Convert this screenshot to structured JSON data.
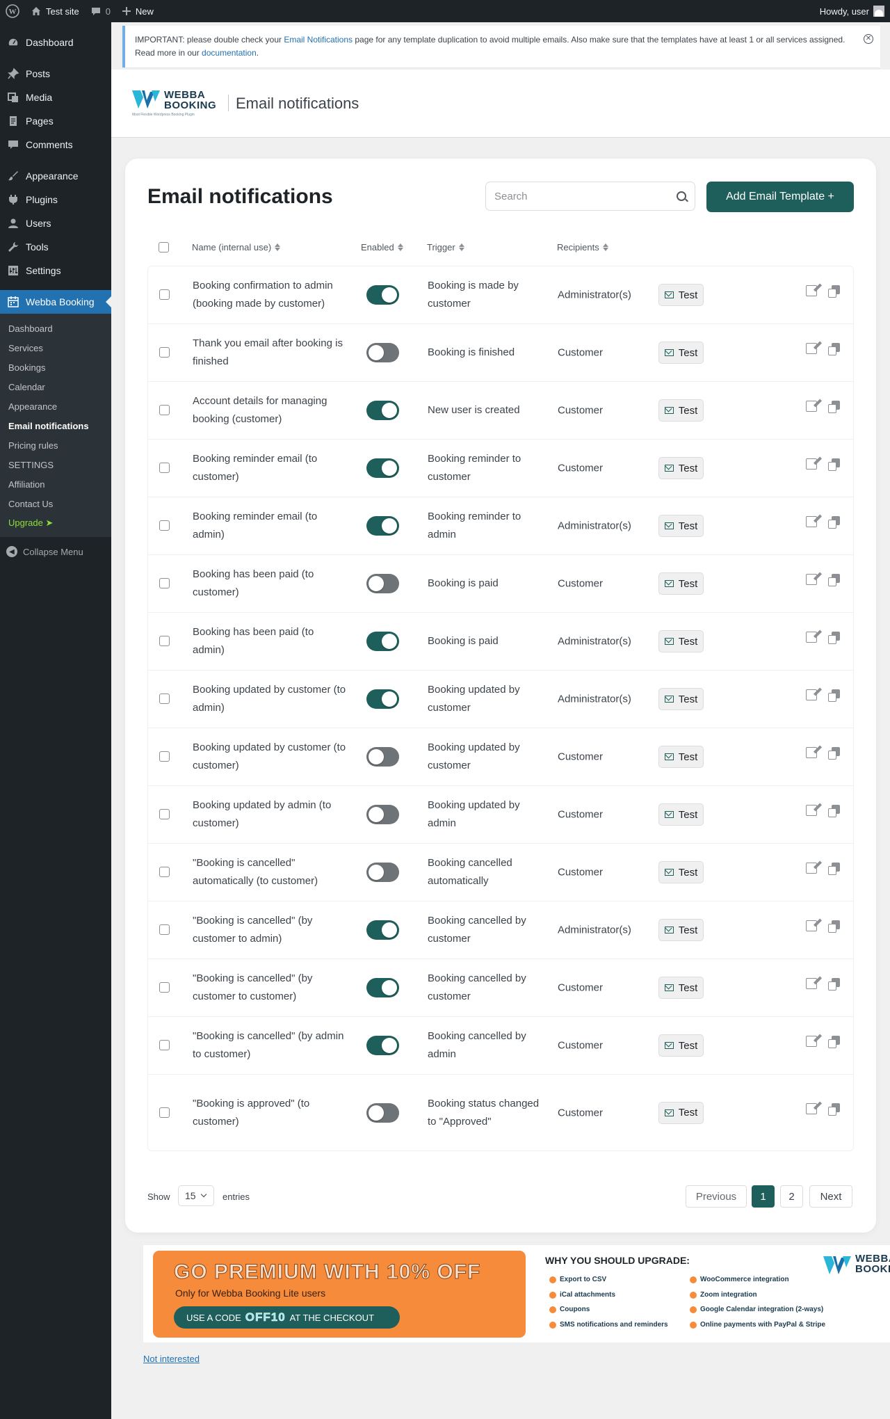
{
  "adminbar": {
    "site_name": "Test site",
    "comments_count": "0",
    "new_label": "New",
    "howdy": "Howdy, user"
  },
  "sidebar": {
    "items": [
      {
        "label": "Dashboard",
        "icon": "dashboard-icon"
      },
      {
        "label": "Posts",
        "icon": "pin-icon"
      },
      {
        "label": "Media",
        "icon": "media-icon"
      },
      {
        "label": "Pages",
        "icon": "pages-icon"
      },
      {
        "label": "Comments",
        "icon": "comment-icon"
      },
      {
        "label": "Appearance",
        "icon": "brush-icon"
      },
      {
        "label": "Plugins",
        "icon": "plug-icon"
      },
      {
        "label": "Users",
        "icon": "user-icon"
      },
      {
        "label": "Tools",
        "icon": "wrench-icon"
      },
      {
        "label": "Settings",
        "icon": "settings-icon"
      },
      {
        "label": "Webba Booking",
        "icon": "calendar-icon"
      }
    ],
    "submenu": [
      "Dashboard",
      "Services",
      "Bookings",
      "Calendar",
      "Appearance",
      "Email notifications",
      "Pricing rules",
      "SETTINGS",
      "Affiliation",
      "Contact Us",
      "Upgrade ➤"
    ],
    "collapse_label": "Collapse Menu"
  },
  "notice": {
    "text_before": "IMPORTANT: please double check your ",
    "link1": "Email Notifications",
    "text_middle": " page for any template duplication to avoid multiple emails. Also make sure that the templates have at least 1 or all services assigned. Read more in our ",
    "link2": "documentation",
    "text_after": "."
  },
  "header": {
    "logo_line1": "WEBBA",
    "logo_line2": "BOOKING",
    "logo_tagline": "Most Flexible Wordpress Booking Plugin",
    "title": "Email notifications"
  },
  "main": {
    "title": "Email notifications",
    "search_placeholder": "Search",
    "add_button": "Add Email Template +",
    "columns": {
      "name": "Name (internal use)",
      "enabled": "Enabled",
      "trigger": "Trigger",
      "recipients": "Recipients"
    },
    "test_label": "Test",
    "rows": [
      {
        "name": "Booking confirmation to admin (booking made by customer)",
        "enabled": true,
        "trigger": "Booking is made by customer",
        "recipients": "Administrator(s)"
      },
      {
        "name": "Thank you email after booking is finished",
        "enabled": false,
        "trigger": "Booking is finished",
        "recipients": "Customer"
      },
      {
        "name": "Account details for managing booking (customer)",
        "enabled": true,
        "trigger": "New user is created",
        "recipients": "Customer"
      },
      {
        "name": "Booking reminder email (to customer)",
        "enabled": true,
        "trigger": "Booking reminder to customer",
        "recipients": "Customer"
      },
      {
        "name": "Booking reminder email (to admin)",
        "enabled": true,
        "trigger": "Booking reminder to admin",
        "recipients": "Administrator(s)"
      },
      {
        "name": "Booking has been paid (to customer)",
        "enabled": false,
        "trigger": "Booking is paid",
        "recipients": "Customer"
      },
      {
        "name": "Booking has been paid (to admin)",
        "enabled": true,
        "trigger": "Booking is paid",
        "recipients": "Administrator(s)"
      },
      {
        "name": "Booking updated by customer (to admin)",
        "enabled": true,
        "trigger": "Booking updated by customer",
        "recipients": "Administrator(s)"
      },
      {
        "name": "Booking updated by customer (to customer)",
        "enabled": false,
        "trigger": "Booking updated by customer",
        "recipients": "Customer"
      },
      {
        "name": "Booking updated by admin (to customer)",
        "enabled": false,
        "trigger": "Booking updated by admin",
        "recipients": "Customer"
      },
      {
        "name": "\"Booking is cancelled\" automatically (to customer)",
        "enabled": false,
        "trigger": "Booking cancelled automatically",
        "recipients": "Customer"
      },
      {
        "name": "\"Booking is cancelled\" (by customer to admin)",
        "enabled": true,
        "trigger": "Booking cancelled by customer",
        "recipients": "Administrator(s)"
      },
      {
        "name": "\"Booking is cancelled\" (by customer to customer)",
        "enabled": true,
        "trigger": "Booking cancelled by customer",
        "recipients": "Customer"
      },
      {
        "name": "\"Booking is cancelled\" (by admin to customer)",
        "enabled": true,
        "trigger": "Booking cancelled by admin",
        "recipients": "Customer"
      },
      {
        "name": "\"Booking is approved\" (to customer)",
        "enabled": false,
        "trigger": "Booking status changed to \"Approved\"",
        "recipients": "Customer"
      }
    ],
    "footer": {
      "show": "Show",
      "page_size": "15",
      "entries": "entries",
      "previous": "Previous",
      "page1": "1",
      "page2": "2",
      "next": "Next"
    }
  },
  "promo": {
    "headline": "GO PREMIUM WITH 10% OFF",
    "subline": "Only for Webba Booking Lite users",
    "code_prefix": "USE A CODE",
    "code": "OFF10",
    "code_suffix": "AT THE CHECKOUT",
    "why_title": "WHY YOU SHOULD UPGRADE:",
    "features_left": [
      "Export to CSV",
      "iCal attachments",
      "Coupons",
      "SMS notifications and reminders"
    ],
    "features_right": [
      "WooCommerce integration",
      "Zoom integration",
      "Google Calendar integration (2-ways)",
      "Online payments with PayPal & Stripe"
    ],
    "logo_line1": "WEBBA",
    "logo_line2": "BOOKI"
  },
  "not_interested": "Not interested",
  "colors": {
    "accent": "#1f5f5b",
    "wp_dark": "#1d2327",
    "wp_blue": "#2271b1",
    "promo_orange": "#f68b3c"
  }
}
